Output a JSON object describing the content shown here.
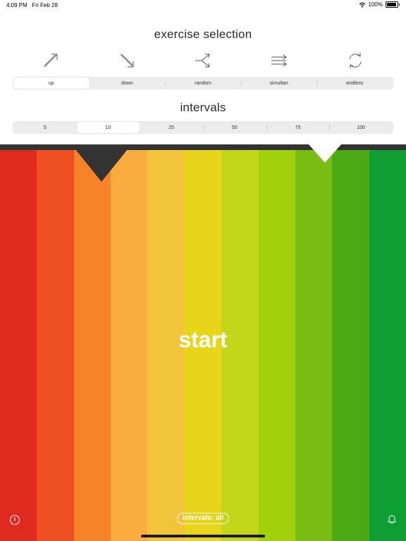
{
  "status_bar": {
    "time": "4:09 PM",
    "date": "Fri Feb 28",
    "battery": "100%",
    "wifi_icon": "wifi-icon",
    "battery_icon": "battery-icon"
  },
  "exercise_selection": {
    "title": "exercise selection",
    "icons": [
      "arrow-up-right-icon",
      "arrow-down-right-icon",
      "random-split-icon",
      "simultaneous-arrows-icon",
      "endless-cycle-icon"
    ],
    "options": [
      "up",
      "down",
      "random",
      "simultan",
      "endless"
    ],
    "selected": "up"
  },
  "intervals": {
    "title": "intervals",
    "options": [
      "5",
      "10",
      "25",
      "50",
      "75",
      "100"
    ],
    "selected": "10"
  },
  "stripe_colors": [
    "#df2a1f",
    "#ee4f22",
    "#f6832a",
    "#fbac3f",
    "#f2c43a",
    "#e7d51c",
    "#c4d61a",
    "#a2d00a",
    "#79bc12",
    "#4ba914",
    "#0f9e34"
  ],
  "start_label": "start",
  "footer": {
    "info_icon": "info-icon",
    "info_glyph": "i",
    "intervals_label": "intervals: all",
    "bell_icon": "bell-icon"
  }
}
